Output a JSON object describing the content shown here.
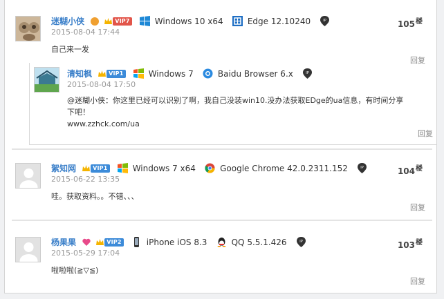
{
  "comments": [
    {
      "username": "迷糊小侠",
      "vip": "VIP7",
      "os": "Windows 10 x64",
      "browser": "Edge 12.10240",
      "date": "2015-08-04 17:44",
      "content": "自己来一发",
      "floor": "105",
      "reply": "回复",
      "nested": {
        "username": "清知枫",
        "vip": "VIP1",
        "os": "Windows 7",
        "browser": "Baidu Browser 6.x",
        "date": "2015-08-04 17:50",
        "content_line1": "@迷糊小侠：你这里已经可以识别了啊，我自己没装win10.没办法获取EDge的ua信息，有时间分享",
        "content_line2": "下吧！",
        "content_line3": "www.zzhck.com/ua",
        "reply": "回复"
      }
    },
    {
      "username": "絮知网",
      "vip": "VIP1",
      "os": "Windows 7 x64",
      "browser": "Google Chrome 42.0.2311.152",
      "date": "2015-06-22 13:35",
      "content": "哇。获取资料。。不错、、、",
      "floor": "104",
      "reply": "回复"
    },
    {
      "username": "杨果果",
      "vip": "VIP2",
      "os": "iPhone iOS 8.3",
      "browser": "QQ 5.5.1.426",
      "date": "2015-05-29 17:04",
      "content": "啦啦啦(≧▽≦)",
      "floor": "103",
      "reply": "回复"
    }
  ],
  "floor_suffix": "楼"
}
